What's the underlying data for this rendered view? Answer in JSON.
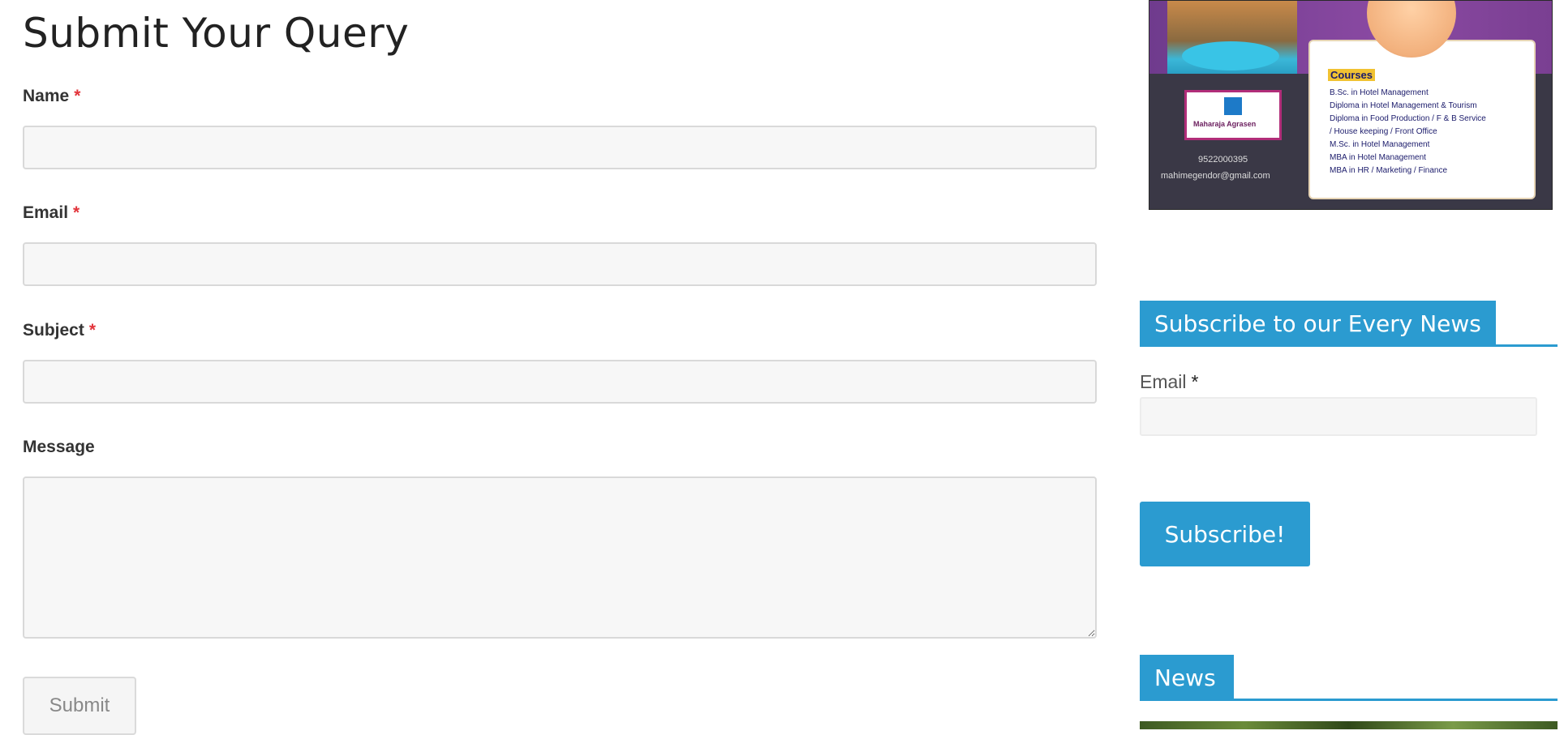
{
  "form": {
    "title": "Submit Your Query",
    "name_label": "Name",
    "email_label": "Email",
    "subject_label": "Subject",
    "message_label": "Message",
    "required_mark": "*",
    "name_value": "",
    "email_value": "",
    "subject_value": "",
    "message_value": "",
    "submit_label": "Submit"
  },
  "sidebar": {
    "ad": {
      "courses_title": "Courses",
      "courses": [
        "B.Sc. in Hotel Management",
        "Diploma in Hotel Management & Tourism",
        "Diploma in Food Production / F & B Service",
        "/ House keeping / Front Office",
        "M.Sc. in Hotel Management",
        "MBA in Hotel Management",
        "MBA in HR / Marketing / Finance"
      ],
      "logo_text": "Maharaja Agrasen",
      "phone": "9522000395",
      "email": "mahimegendor@gmail.com"
    },
    "subscribe": {
      "title": "Subscribe to our Every News",
      "email_label": "Email",
      "required_mark": "*",
      "email_value": "",
      "button_label": "Subscribe!"
    },
    "news": {
      "title": "News"
    }
  },
  "colors": {
    "accent": "#2b9bd0",
    "required": "#e2343b"
  }
}
